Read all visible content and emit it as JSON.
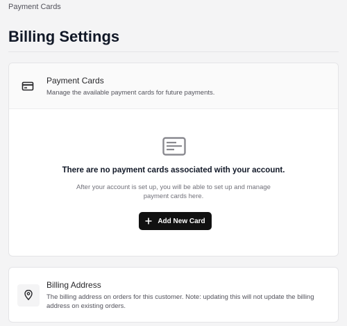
{
  "breadcrumb": "Payment Cards",
  "page_title": "Billing Settings",
  "payment_cards": {
    "icon": "credit-card-icon",
    "title": "Payment Cards",
    "description": "Manage the available payment cards for future payments.",
    "empty_icon": "credit-card-outline-icon",
    "empty_title": "There are no payment cards associated with your account.",
    "empty_description": "After your account is set up, you will be able to set up and manage payment cards here.",
    "add_button_label": "Add New Card",
    "add_button_icon": "plus-icon"
  },
  "billing_address": {
    "icon": "map-pin-icon",
    "title": "Billing Address",
    "description": "The billing address on orders for this customer. Note: updating this will not update the billing address on existing orders."
  },
  "colors": {
    "background": "#f4f4f5",
    "card": "#ffffff",
    "primary_button": "#111111",
    "muted_text": "#71717a"
  }
}
